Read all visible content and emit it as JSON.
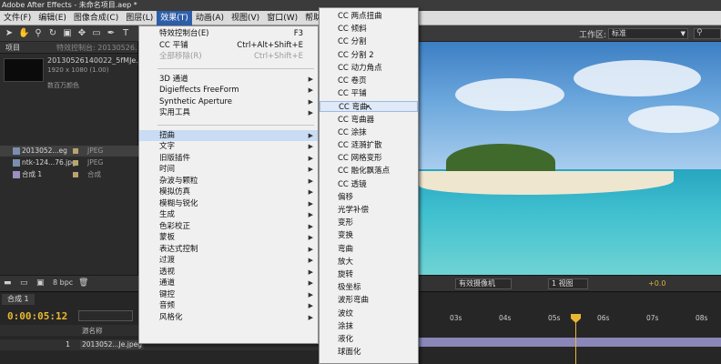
{
  "app": {
    "title": "Adobe After Effects - 未命名项目.aep *"
  },
  "menubar": {
    "items": [
      "文件(F)",
      "编辑(E)",
      "图像合成(C)",
      "图层(L)",
      "效果(T)",
      "动画(A)",
      "视图(V)",
      "窗口(W)",
      "帮助(H)"
    ],
    "active": "效果(T)"
  },
  "toolbar": {
    "workspace_label": "工作区:",
    "workspace_value": "标准"
  },
  "project": {
    "tab_label": "项目",
    "tab2_label": "特效控制台: 20130526...",
    "file_name": "20130526140022_5fMJe.jpe",
    "file_res": "1920 x 1080 (1.00)",
    "file_color": "数百万颜色",
    "rows": [
      {
        "name": "2013052...eg",
        "type": "JPEG"
      },
      {
        "name": "ntk-124...76.jpg",
        "type": "JPEG"
      },
      {
        "name": "合成 1",
        "type": "合成"
      }
    ],
    "bpc": "8 bpc"
  },
  "effects_menu": {
    "items": [
      {
        "label": "特效控制台(E)",
        "shortcut": "F3"
      },
      {
        "label": "CC 平铺",
        "shortcut": "Ctrl+Alt+Shift+E"
      },
      {
        "label": "全部移除(R)",
        "shortcut": "Ctrl+Shift+E",
        "disabled": true
      },
      {
        "label": "3D 通道",
        "submenu": true
      },
      {
        "label": "Digieffects FreeForm",
        "submenu": true
      },
      {
        "label": "Synthetic Aperture",
        "submenu": true
      },
      {
        "label": "实用工具",
        "submenu": true
      },
      {
        "label": "扭曲",
        "submenu": true,
        "highlighted": true
      },
      {
        "label": "文字",
        "submenu": true
      },
      {
        "label": "旧版插件",
        "submenu": true
      },
      {
        "label": "时间",
        "submenu": true
      },
      {
        "label": "杂波与颗粒",
        "submenu": true
      },
      {
        "label": "模拟仿真",
        "submenu": true
      },
      {
        "label": "模糊与锐化",
        "submenu": true
      },
      {
        "label": "生成",
        "submenu": true
      },
      {
        "label": "色彩校正",
        "submenu": true
      },
      {
        "label": "蒙板",
        "submenu": true
      },
      {
        "label": "表达式控制",
        "submenu": true
      },
      {
        "label": "过渡",
        "submenu": true
      },
      {
        "label": "透视",
        "submenu": true
      },
      {
        "label": "通道",
        "submenu": true
      },
      {
        "label": "键控",
        "submenu": true
      },
      {
        "label": "音频",
        "submenu": true
      },
      {
        "label": "风格化",
        "submenu": true
      }
    ]
  },
  "distort_menu": {
    "items": [
      "CC 两点扭曲",
      "CC 倾斜",
      "CC 分割",
      "CC 分割 2",
      "CC 动力角点",
      "CC 卷页",
      "CC 平铺",
      "CC 弯曲",
      "CC 弯曲器",
      "CC 涂抹",
      "CC 涟漪扩散",
      "CC 网格变形",
      "CC 融化飘落点",
      "CC 透镜",
      "偏移",
      "光学补偿",
      "变形",
      "变换",
      "弯曲",
      "放大",
      "旋转",
      "极坐标",
      "波形弯曲",
      "波纹",
      "涂抹",
      "液化",
      "球面化"
    ],
    "highlighted": "CC 弯曲"
  },
  "viewer": {
    "camera": "有效摄像机",
    "views": "1 视图",
    "exposure": "+0.0"
  },
  "timeline": {
    "tab": "合成 1",
    "timecode": "0:00:05:12",
    "column_header": "源名称",
    "layer_num": "1",
    "layer_name": "2013052...Je.jpeg",
    "ticks": [
      "03s",
      "04s",
      "05s",
      "06s",
      "07s",
      "08s"
    ]
  }
}
